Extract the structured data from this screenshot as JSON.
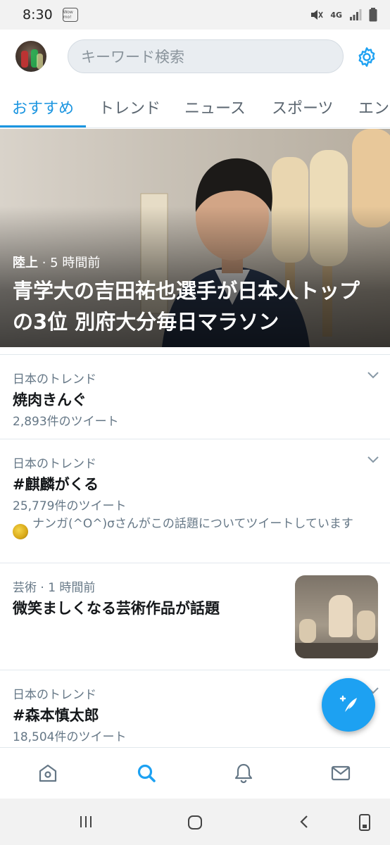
{
  "status_bar": {
    "time": "8:30",
    "app_badge": "Wow mo!",
    "network": "4G"
  },
  "header": {
    "search_placeholder": "キーワード検索",
    "settings_icon": "gear-icon"
  },
  "tabs": [
    {
      "label": "おすすめ",
      "active": true
    },
    {
      "label": "トレンド"
    },
    {
      "label": "ニュース"
    },
    {
      "label": "スポーツ"
    },
    {
      "label": "エンターテインメント"
    }
  ],
  "hero": {
    "category": "陸上",
    "time": " · 5 時間前",
    "title": "青学大の吉田祐也選手が日本人トップの3位 別府大分毎日マラソン"
  },
  "trends": [
    {
      "label": "日本のトレンド",
      "title": "焼肉きんぐ",
      "count": "2,893件のツイート"
    },
    {
      "label": "日本のトレンド",
      "title": "#麒麟がくる",
      "count": "25,779件のツイート",
      "context": "ナンガ(^O^)σさんがこの話題についてツイートしています"
    },
    {
      "label": "芸術 · 1 時間前",
      "title": "微笑ましくなる芸術作品が話題"
    },
    {
      "label": "日本のトレンド",
      "title": "#森本慎太郎",
      "count": "18,504件のツイート"
    }
  ],
  "colors": {
    "accent": "#1da1f2",
    "tab_active": "#1b95e0",
    "secondary_text": "#657786"
  },
  "bottom_nav": [
    "home-icon",
    "search-icon",
    "notifications-icon",
    "messages-icon"
  ],
  "fab": {
    "icon": "compose-tweet-icon"
  }
}
